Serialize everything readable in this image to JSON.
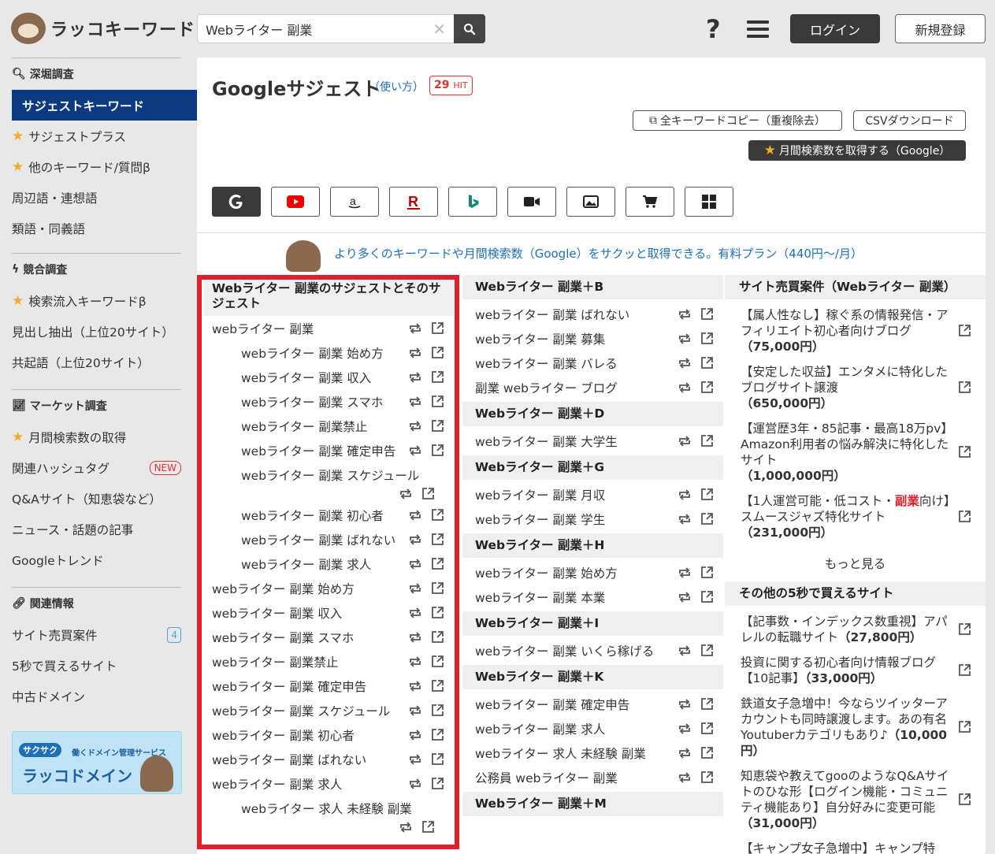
{
  "header": {
    "logo": "ラッコキーワード",
    "search_value": "Webライター 副業",
    "help": "?",
    "login": "ログイン",
    "signup": "新規登録"
  },
  "sidebar": {
    "sec1": "深堀調査",
    "sec1_items": [
      "サジェストキーワード",
      "サジェストプラス",
      "他のキーワード/質問β",
      "周辺語・連想語",
      "類語・同義語"
    ],
    "sec2": "競合調査",
    "sec2_items": [
      "検索流入キーワードβ",
      "見出し抽出（上位20サイト）",
      "共起語（上位20サイト）"
    ],
    "sec3": "マーケット調査",
    "sec3_items": [
      "月間検索数の取得",
      "関連ハッシュタグ",
      "Q&Aサイト（知恵袋など）",
      "ニュース・話題の記事",
      "Googleトレンド"
    ],
    "new_badge": "NEW",
    "sec4": "関連情報",
    "sec4_items": [
      "サイト売買案件",
      "5秒で買えるサイト",
      "中古ドメイン"
    ],
    "count_badge": "4",
    "banner": {
      "tag": "サクサク",
      "sub": "働くドメイン管理サービス",
      "name": "ラッコドメイン"
    }
  },
  "main": {
    "title": "Googleサジェスト",
    "howto": "（使い方）",
    "hits": "29",
    "hit_label": "HIT",
    "copy_all": "全キーワードコピー（重複除去）",
    "csv": "CSVダウンロード",
    "monthly": "月間検索数を取得する（Google）",
    "promo": "より多くのキーワードや月間検索数（Google）をサクッと取得できる。有料プラン（440円〜/月）"
  },
  "engines": [
    "google-icon",
    "youtube-icon",
    "amazon-icon",
    "rakuten-icon",
    "bing-icon",
    "video-icon",
    "image-icon",
    "shopping-icon",
    "apps-icon"
  ],
  "col1": {
    "heading": "Webライター 副業のサジェストとそのサジェスト",
    "rows": [
      {
        "k": "webライター 副業",
        "sub": false
      },
      {
        "k": "webライター 副業 始め方",
        "sub": true
      },
      {
        "k": "webライター 副業 収入",
        "sub": true
      },
      {
        "k": "webライター 副業 スマホ",
        "sub": true
      },
      {
        "k": "webライター 副業禁止",
        "sub": true
      },
      {
        "k": "webライター 副業 確定申告",
        "sub": true
      },
      {
        "k": "webライター 副業 スケジュール",
        "sub": true,
        "wrap": true
      },
      {
        "k": "webライター 副業 初心者",
        "sub": true
      },
      {
        "k": "webライター 副業 ばれない",
        "sub": true
      },
      {
        "k": "webライター 副業 求人",
        "sub": true
      },
      {
        "k": "webライター 副業 始め方",
        "sub": false
      },
      {
        "k": "webライター 副業 収入",
        "sub": false
      },
      {
        "k": "webライター 副業 スマホ",
        "sub": false
      },
      {
        "k": "webライター 副業禁止",
        "sub": false
      },
      {
        "k": "webライター 副業 確定申告",
        "sub": false
      },
      {
        "k": "webライター 副業 スケジュール",
        "sub": false
      },
      {
        "k": "webライター 副業 初心者",
        "sub": false
      },
      {
        "k": "webライター 副業 ばれない",
        "sub": false
      },
      {
        "k": "webライター 副業 求人",
        "sub": false
      },
      {
        "k": "webライター 求人 未経験 副業",
        "sub": true,
        "wrap": true
      }
    ]
  },
  "col2": [
    {
      "heading": "Webライター 副業＋B",
      "rows": [
        "webライター 副業 ばれない",
        "webライター 副業 募集",
        "webライター 副業 バレる",
        "副業 webライター ブログ"
      ]
    },
    {
      "heading": "Webライター 副業＋D",
      "rows": [
        "webライター 副業 大学生"
      ]
    },
    {
      "heading": "Webライター 副業＋G",
      "rows": [
        "webライター 副業 月収",
        "webライター 副業 学生"
      ]
    },
    {
      "heading": "Webライター 副業＋H",
      "rows": [
        "webライター 副業 始め方",
        "webライター 副業 本業"
      ]
    },
    {
      "heading": "Webライター 副業＋I",
      "rows": [
        "webライター 副業 いくら稼げる"
      ]
    },
    {
      "heading": "Webライター 副業＋K",
      "rows": [
        "webライター 副業 確定申告",
        "webライター 副業 求人",
        "webライター 求人 未経験 副業",
        "公務員 webライター 副業"
      ]
    },
    {
      "heading": "Webライター 副業＋M",
      "rows": []
    }
  ],
  "col3": {
    "heading1": "サイト売買案件（Webライター 副業）",
    "deals": [
      {
        "t": "【属人性なし】稼ぐ系の情報発信・アフィリエイト初心者向けブログ",
        "p": "（75,000円）"
      },
      {
        "t": "【安定した収益】エンタメに特化したブログサイト譲渡",
        "p": "（650,000円）"
      },
      {
        "t": "【運営歴3年・85記事・最高18万pv】Amazon利用者の悩み解決に特化したサイト",
        "p": "（1,000,000円）"
      },
      {
        "t1": "【1人運営可能・低コスト・",
        "hl": "副業",
        "t2": "向け】スムースジャズ特化サイト",
        "p": "（231,000円）"
      }
    ],
    "more": "もっと見る",
    "heading2": "その他の5秒で買えるサイト",
    "sites": [
      {
        "t": "【記事数・インデックス数重視】アパレルの転職サイト",
        "p": "（27,800円）"
      },
      {
        "t": "投資に関する初心者向け情報ブログ【10記事】",
        "p": "（33,000円）"
      },
      {
        "t": "鉄道女子急増中！今ならツイッターアカウントも同時譲渡します。あの有名Youtuberカテゴリもあり♪",
        "p": "（10,000円）"
      },
      {
        "t": "知恵袋や教えてgooのようなQ&Aサイトのひな形【ログイン機能・コミュニティ機能あり】自分好みに変更可能",
        "p": "（31,000円）"
      },
      {
        "t": "【キャンプ女子急増中】キャンプ特",
        "p": ""
      }
    ]
  }
}
